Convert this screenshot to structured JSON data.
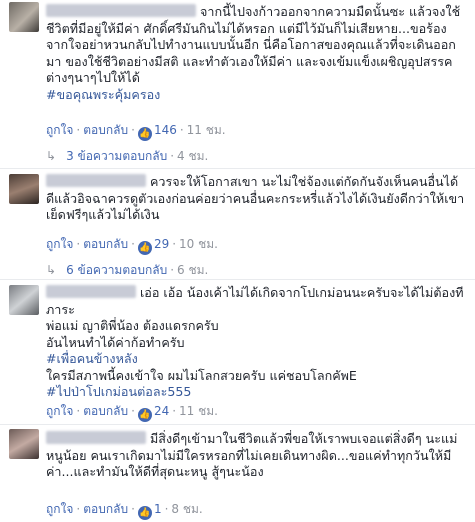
{
  "comments": [
    {
      "text": "จากนี้ไปจงก้าวออกจากความมืดนั้นซะ แล้วจงใช้ชีวิตที่มีอยู่ให้มีค่า ศักดิ์ศรีมันกินไม่ได้หรอก แต่มีไว้มันก็ไม่เสียหาย...ขอร้องจากใจอย่าหวนกลับไปทำงานแบบนั้นอีก นี่คือโอกาสของคุณแล้วที่จะเดินออกมา ของใช้ชีวิตอย่างมีสติ และทำตัวเองให้มีค่า และจงเข้มแข็งเผชิญอุปสรรคต่างๆนาๆไปให้ได้",
      "hashtag": "#ขอคุณพระคุ้มครอง",
      "like_label": "ถูกใจ",
      "reply_label": "ตอบกลับ",
      "likes": "146",
      "time": "11 ชม.",
      "replies_label": "3 ข้อความตอบกลับ",
      "replies_time": "4 ชม."
    },
    {
      "text": "ควรจะให้โอกาสเขา นะไม่ใช่จ้องแต่กัดกันจังเห็นคนอื่นได้ดีแล้วอิจฉาควรดูตัวเองก่อนค่อยว่าคนอื่นคะกระหรี่แล้วไงได้เงินยังดีกว่าให้เขาเย็ดฟรีๆแล้วไม่ได้เงิน",
      "like_label": "ถูกใจ",
      "reply_label": "ตอบกลับ",
      "likes": "29",
      "time": "10 ชม.",
      "replies_label": "6 ข้อความตอบกลับ",
      "replies_time": "6 ชม."
    },
    {
      "line1": "เอ่อ เอ้อ น้องเค้าไม่ได้เกิดจากโปเกม่อนนะครับจะได้ไม่ต้องทีภาระ",
      "line2": "พ่อแม่ ญาติพี่น้อง ต้องแดรกครับ",
      "line3": "อันไหนทำได้ค่าก้อทำครับ",
      "hashtag1": "#เพื่อคนข้างหลัง",
      "line4": "ใครมีสภาพนี้คงเข้าใจ ผมไม่โลกสวยครับ แค่ชอบโลกคัพE",
      "hashtag2": "#ไปป่าโปเกม่อนต่อละ555",
      "like_label": "ถูกใจ",
      "reply_label": "ตอบกลับ",
      "likes": "24",
      "time": "11 ชม."
    },
    {
      "text": "มีสิ่งดีๆเข้ามาในชีวิตแล้วพี่ขอให้เราพบเจอแต่สิ่งดีๆ นะแม่หนูน้อย คนเราเกิดมาไม่มีใครหรอกที่ไม่เคยเดินทางผิด...ขอแค่ทำทุกวันให้มีค่า...และทำมันให้ดีที่สุดนะหนู สู้ๆนะน้อง",
      "like_label": "ถูกใจ",
      "reply_label": "ตอบกลับ",
      "likes": "1",
      "time": "8 ชม."
    }
  ],
  "colors": {
    "link": "#4267b2",
    "meta": "#90949c",
    "hashtag": "#365899"
  },
  "icons": {
    "like": "thumbs-up-icon",
    "reply_arrow": "reply-arrow-icon"
  }
}
